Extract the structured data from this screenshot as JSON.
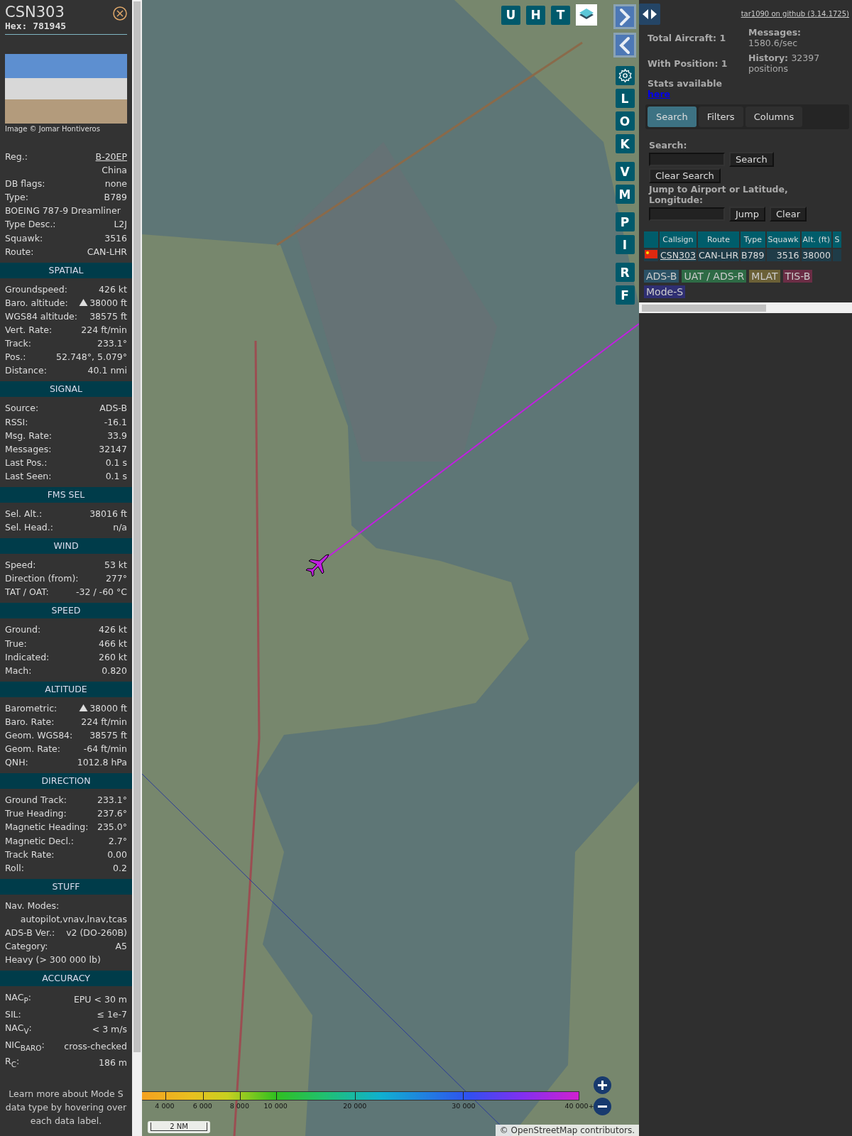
{
  "detail": {
    "callsign": "CSN303",
    "hex": "Hex: 781945",
    "photo_credit": "Image © Jomar Hontiveros",
    "sections": [
      {
        "rows": [
          {
            "kind": "pair",
            "label": "Reg.:",
            "value": "B-20EP",
            "link": true
          },
          {
            "kind": "value",
            "value": "China"
          },
          {
            "kind": "pair",
            "label": "DB flags:",
            "value": "none"
          },
          {
            "kind": "pair",
            "label": "Type:",
            "value": "B789"
          },
          {
            "kind": "full",
            "value": "BOEING 787-9 Dreamliner"
          },
          {
            "kind": "pair",
            "label": "Type Desc.:",
            "value": "L2J"
          },
          {
            "kind": "pair",
            "label": "Squawk:",
            "value": "3516"
          },
          {
            "kind": "pair",
            "label": "Route:",
            "value": "CAN-LHR"
          }
        ]
      },
      {
        "title": "SPATIAL",
        "rows": [
          {
            "kind": "pair",
            "label": "Groundspeed:",
            "value": "426 kt"
          },
          {
            "kind": "pair",
            "label": "Baro. altitude:",
            "value": "38000 ft",
            "climbing": true
          },
          {
            "kind": "pair",
            "label": "WGS84 altitude:",
            "value": "38575 ft"
          },
          {
            "kind": "pair",
            "label": "Vert. Rate:",
            "value": "224 ft/min"
          },
          {
            "kind": "pair",
            "label": "Track:",
            "value": "233.1°"
          },
          {
            "kind": "pair",
            "label": "Pos.:",
            "value": "52.748°, 5.079°"
          },
          {
            "kind": "pair",
            "label": "Distance:",
            "value": "40.1 nmi"
          }
        ]
      },
      {
        "title": "SIGNAL",
        "rows": [
          {
            "kind": "pair",
            "label": "Source:",
            "value": "ADS-B"
          },
          {
            "kind": "pair",
            "label": "RSSI:",
            "value": "-16.1"
          },
          {
            "kind": "pair",
            "label": "Msg. Rate:",
            "value": "33.9"
          },
          {
            "kind": "pair",
            "label": "Messages:",
            "value": "32147"
          },
          {
            "kind": "pair",
            "label": "Last Pos.:",
            "value": "0.1 s"
          },
          {
            "kind": "pair",
            "label": "Last Seen:",
            "value": "0.1 s"
          }
        ]
      },
      {
        "title": "FMS SEL",
        "rows": [
          {
            "kind": "pair",
            "label": "Sel. Alt.:",
            "value": "38016 ft"
          },
          {
            "kind": "pair",
            "label": "Sel. Head.:",
            "value": "n/a"
          }
        ]
      },
      {
        "title": "WIND",
        "rows": [
          {
            "kind": "pair",
            "label": "Speed:",
            "value": "53 kt"
          },
          {
            "kind": "pair",
            "label": "Direction (from):",
            "value": "277°"
          },
          {
            "kind": "pair",
            "label": "TAT / OAT:",
            "value": "-32 / -60 °C"
          }
        ]
      },
      {
        "title": "SPEED",
        "rows": [
          {
            "kind": "pair",
            "label": "Ground:",
            "value": "426 kt"
          },
          {
            "kind": "pair",
            "label": "True:",
            "value": "466 kt"
          },
          {
            "kind": "pair",
            "label": "Indicated:",
            "value": "260 kt"
          },
          {
            "kind": "pair",
            "label": "Mach:",
            "value": "0.820"
          }
        ]
      },
      {
        "title": "ALTITUDE",
        "rows": [
          {
            "kind": "pair",
            "label": "Barometric:",
            "value": "38000 ft",
            "climbing": true
          },
          {
            "kind": "pair",
            "label": "Baro. Rate:",
            "value": "224 ft/min"
          },
          {
            "kind": "pair",
            "label": "Geom. WGS84:",
            "value": "38575 ft"
          },
          {
            "kind": "pair",
            "label": "Geom. Rate:",
            "value": "-64 ft/min"
          },
          {
            "kind": "pair",
            "label": "QNH:",
            "value": "1012.8 hPa"
          }
        ]
      },
      {
        "title": "DIRECTION",
        "rows": [
          {
            "kind": "pair",
            "label": "Ground Track:",
            "value": "233.1°"
          },
          {
            "kind": "pair",
            "label": "True Heading:",
            "value": "237.6°"
          },
          {
            "kind": "pair",
            "label": "Magnetic Heading:",
            "value": "235.0°"
          },
          {
            "kind": "pair",
            "label": "Magnetic Decl.:",
            "value": "2.7°"
          },
          {
            "kind": "pair",
            "label": "Track Rate:",
            "value": "0.00"
          },
          {
            "kind": "pair",
            "label": "Roll:",
            "value": "0.2"
          }
        ]
      },
      {
        "title": "STUFF",
        "rows": [
          {
            "kind": "full",
            "value": "Nav. Modes:"
          },
          {
            "kind": "value",
            "value": "autopilot,vnav,lnav,tcas"
          },
          {
            "kind": "pair",
            "label": "ADS-B Ver.:",
            "value": "v2 (DO-260B)"
          },
          {
            "kind": "pair",
            "label": "Category:",
            "value": "A5"
          },
          {
            "kind": "full",
            "value": "Heavy (> 300 000 lb)"
          }
        ]
      },
      {
        "title": "ACCURACY",
        "rows": [
          {
            "kind": "pair",
            "label": "NAC$_{P}$:",
            "value": "EPU < 30 m"
          },
          {
            "kind": "pair",
            "label": "SIL:",
            "value": "≤ 1e-7"
          },
          {
            "kind": "pair",
            "label": "NAC$_{V}$:",
            "value": "< 3 m/s"
          },
          {
            "kind": "pair",
            "label": "NIC$_{BARO}$:",
            "value": "cross-checked"
          },
          {
            "kind": "pair",
            "label": "R$_{C}$:",
            "value": "186 m"
          }
        ]
      }
    ],
    "footer": "Learn more about Mode S data type by hovering over each data label."
  },
  "map": {
    "top_buttons": [
      {
        "kind": "letter",
        "label": "U"
      },
      {
        "kind": "letter",
        "label": "H"
      },
      {
        "kind": "letter",
        "label": "T"
      },
      {
        "kind": "layers"
      }
    ],
    "side_groups": [
      [
        {
          "kind": "next"
        },
        {
          "kind": "prev"
        }
      ],
      [
        {
          "kind": "settings"
        },
        {
          "kind": "letter",
          "label": "L"
        },
        {
          "kind": "letter",
          "label": "O"
        },
        {
          "kind": "letter",
          "label": "K"
        }
      ],
      [
        {
          "kind": "letter",
          "label": "V"
        },
        {
          "kind": "letter",
          "label": "M"
        }
      ],
      [
        {
          "kind": "letter",
          "label": "P"
        },
        {
          "kind": "letter",
          "label": "I"
        }
      ],
      [
        {
          "kind": "letter",
          "label": "R"
        },
        {
          "kind": "letter",
          "label": "F"
        }
      ]
    ],
    "altitude_scale": [
      "4 000",
      "6 000",
      "8 000",
      "10 000",
      "20 000",
      "30 000",
      "40 000+"
    ],
    "scale_bar": "2 NM",
    "attribution": {
      "prefix": "©",
      "link": "OpenStreetMap",
      "suffix": "contributors."
    }
  },
  "sidebar": {
    "version_link": "tar1090 on github (3.14.1725)",
    "stats": {
      "total": "Total Aircraft: 1",
      "with_position": "With Position: 1",
      "stats_text": "Stats available",
      "stats_link": "here",
      "messages_label": "Messages:",
      "messages_value": "1580.6/sec",
      "history_label": "History:",
      "history_value": "32397 positions"
    },
    "tabs": [
      {
        "label": "Search",
        "selected": true
      },
      {
        "label": "Filters",
        "selected": false
      },
      {
        "label": "Columns",
        "selected": false
      }
    ],
    "search": {
      "label": "Search:",
      "button": "Search",
      "clear_button": "Clear Search",
      "jump_label": "Jump to Airport or Latitude, Longitude:",
      "jump_button": "Jump",
      "jump_clear_button": "Clear"
    },
    "table": {
      "columns": [
        "Callsign",
        "Route",
        "Type",
        "Squawk",
        "Alt. (ft)",
        "S"
      ],
      "rows": [
        {
          "callsign": "CSN303",
          "route": "CAN-LHR",
          "type": "B789",
          "squawk": "3516",
          "altitude": "38000"
        }
      ]
    },
    "legend": [
      {
        "label": "ADS-B",
        "color": "#2b5266"
      },
      {
        "label": "UAT / ADS-R",
        "color": "#2e6b45"
      },
      {
        "label": "MLAT",
        "color": "#6b6036"
      },
      {
        "label": "TIS-B",
        "color": "#6b2d45"
      },
      {
        "label": "Mode-S",
        "color": "#2f2f72"
      }
    ]
  }
}
